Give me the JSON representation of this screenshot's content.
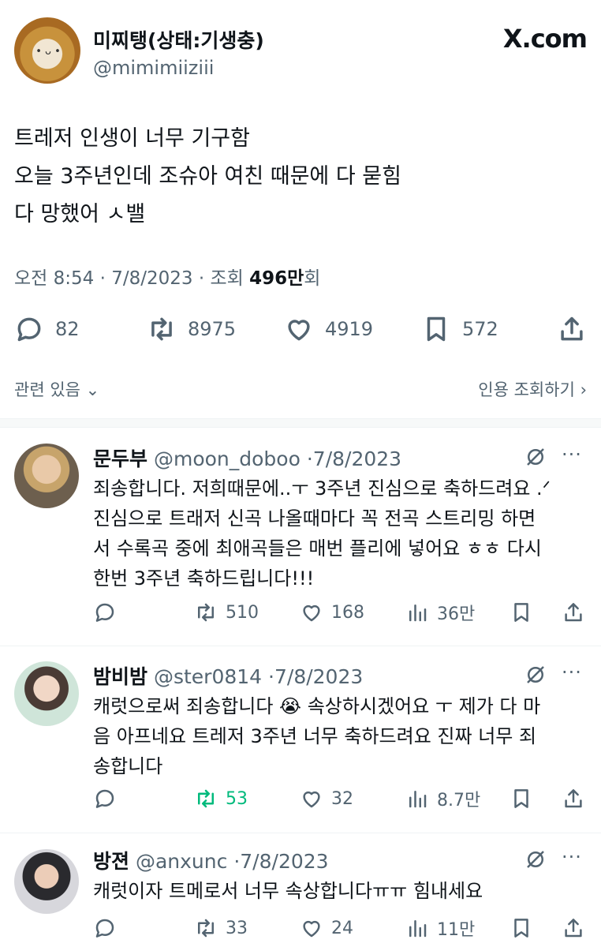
{
  "main_tweet": {
    "author_name": "미찌탱(상태:기생충)",
    "author_handle": "@mimimiiziii",
    "brand": "X.com",
    "text_lines": [
      "트레저 인생이 너무 기구함",
      "오늘 3주년인데 조슈아 여친 때문에 다 묻힘",
      "다 망했어 ㅅ밸"
    ],
    "time": "오전 8:54",
    "date": "7/8/2023",
    "views_label": "조회",
    "views_value": "496만",
    "views_suffix": "회",
    "replies": "82",
    "reposts": "8975",
    "likes": "4919",
    "bookmarks": "572"
  },
  "related": {
    "left_label": "관련 있음",
    "right_label": "인용 조회하기"
  },
  "replies": [
    {
      "name": "문두부",
      "handle": "@moon_doboo",
      "date": "7/8/2023",
      "lines": [
        "죄송합니다. 저희때문에..ㅜ 3주년 진심으로 축하드려요 .ᐟ",
        "진심으로 트래저 신곡 나올때마다 꼭 전곡 스트리밍 하면",
        "서 수록곡 중에 최애곡들은 매번 플리에 넣어요 ㅎㅎ 다시",
        "한번 3주년 축하드립니다!!!"
      ],
      "replies": "",
      "reposts": "510",
      "likes": "168",
      "views": "36만"
    },
    {
      "name": "밤비밤",
      "handle": "@ster0814",
      "date": "7/8/2023",
      "lines": [
        "캐럿으로써 죄송합니다 😭  속상하시겠어요 ㅜ 제가 다 마",
        "음 아프네요 트레저 3주년 너무 축하드려요 진짜 너무 죄",
        "송합니다"
      ],
      "replies": "",
      "reposts": "53",
      "likes": "32",
      "views": "8.7만"
    },
    {
      "name": "방젼",
      "handle": "@anxunc",
      "date": "7/8/2023",
      "lines": [
        "캐럿이자 트메로서 너무 속상합니다ㅠㅠ 힘내세요"
      ],
      "replies": "",
      "reposts": "33",
      "likes": "24",
      "views": "11만"
    }
  ]
}
